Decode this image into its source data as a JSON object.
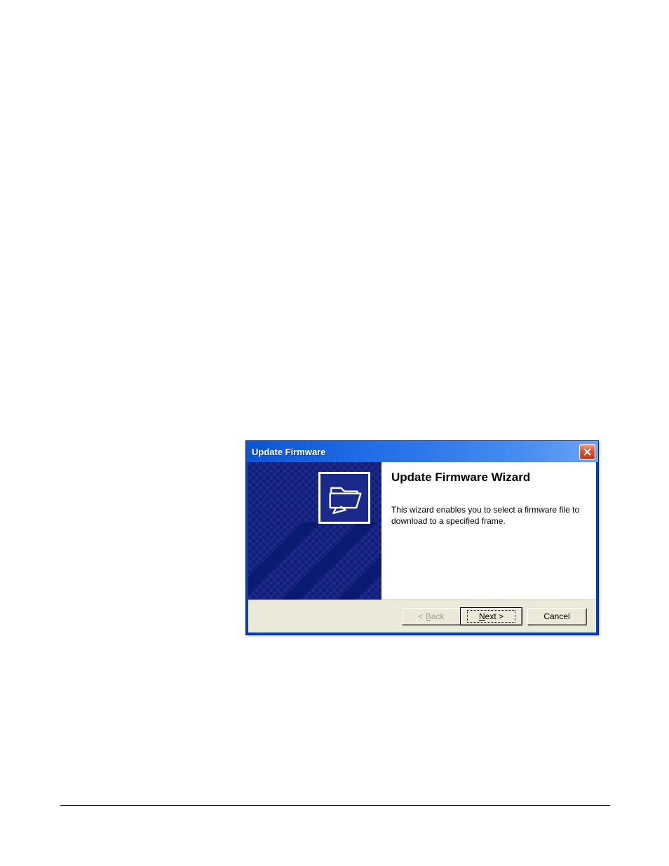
{
  "dialog": {
    "title": "Update Firmware",
    "wizard_heading": "Update Firmware Wizard",
    "wizard_body": "This wizard enables you to select a firmware file to download to a specified frame.",
    "buttons": {
      "back_prefix": "< ",
      "back_mnemonic": "B",
      "back_suffix": "ack",
      "next_mnemonic": "N",
      "next_suffix": "ext >",
      "cancel": "Cancel"
    }
  }
}
